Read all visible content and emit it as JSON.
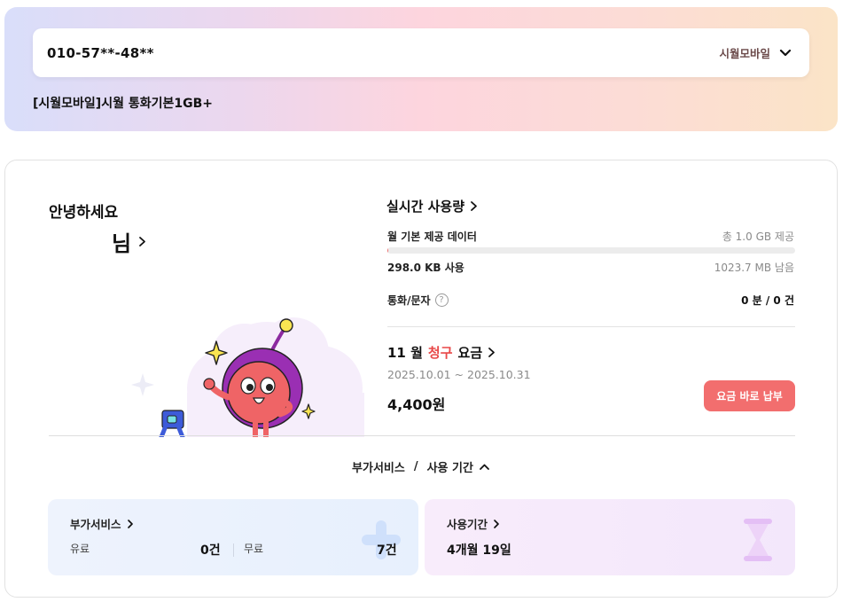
{
  "header": {
    "phone_number": "010-57**-48**",
    "carrier": "시월모바일",
    "plan": "[시월모바일]시월 통화기본1GB+"
  },
  "greeting": {
    "hello": "안녕하세요",
    "user_suffix": "님"
  },
  "usage": {
    "title": "실시간 사용량",
    "data_label": "월 기본 제공 데이터",
    "data_total": "총 1.0 GB 제공",
    "data_used_fraction": 0.0003,
    "data_used": "298.0 KB 사용",
    "data_remaining": "1023.7 MB 남음",
    "voice_label": "통화/문자",
    "voice_value": "0 분 / 0 건"
  },
  "bill": {
    "month": "11 월",
    "highlight": "청구",
    "suffix": "요금",
    "period": "2025.10.01 ~ 2025.10.31",
    "amount": "4,400원",
    "pay_button": "요금 바로 납부"
  },
  "services_toggle": {
    "left": "부가서비스",
    "slash": "/",
    "right": "사용 기간"
  },
  "addon_card": {
    "title": "부가서비스",
    "paid_label": "유료",
    "paid_count": "0건",
    "free_label": "무료",
    "free_count": "7건"
  },
  "period_card": {
    "title": "사용기간",
    "value": "4개월 19일"
  },
  "colors": {
    "accent": "#f26e6e",
    "highlight_red": "#e84848"
  }
}
